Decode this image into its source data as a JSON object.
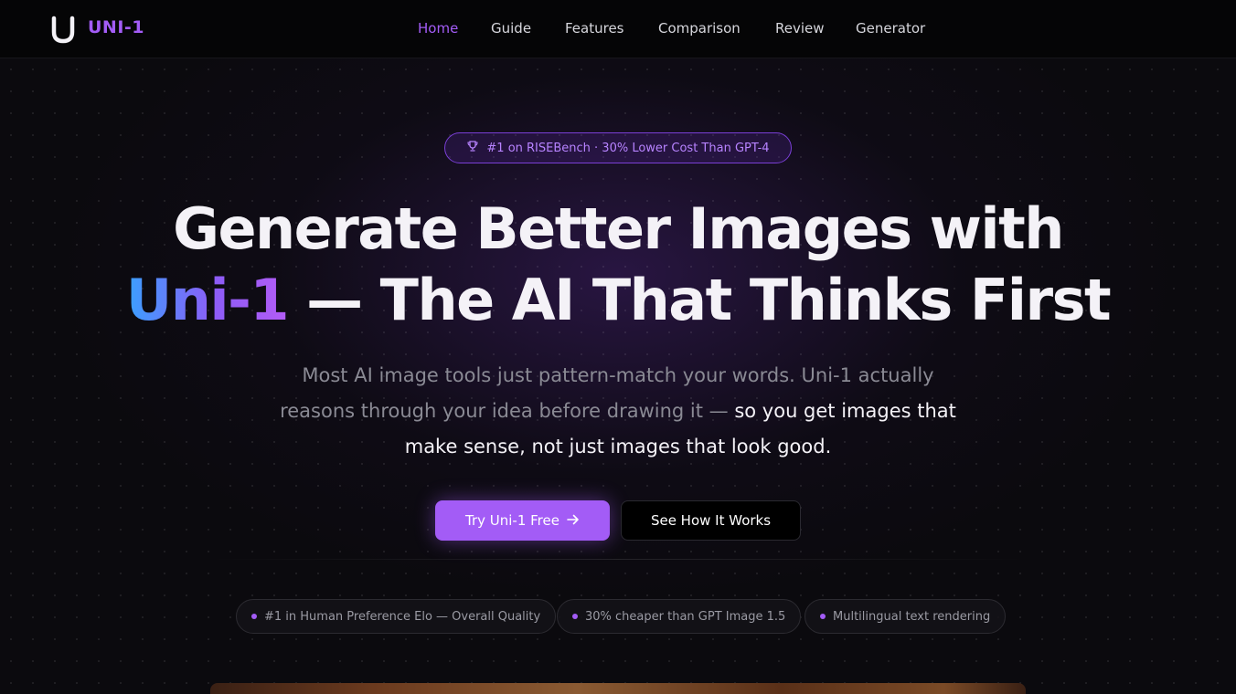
{
  "brand": {
    "name": "UNI-1",
    "logo_letter": "U"
  },
  "nav": {
    "items": [
      {
        "label": "Home",
        "active": true
      },
      {
        "label": "Guide"
      },
      {
        "label": "Features"
      },
      {
        "label": "Comparison"
      },
      {
        "label": "Review"
      },
      {
        "label": "Generator"
      }
    ]
  },
  "hero": {
    "badge": "#1 on RISEBench · 30% Lower Cost Than GPT-4",
    "badge_icon": "trophy-icon",
    "title_line1": "Generate Better Images with",
    "title_accent": "Uni-1",
    "title_line2_rest": " — The AI That Thinks First",
    "subtitle_muted": "Most AI image tools just pattern-match your words. Uni-1 actually reasons through your idea before drawing it — ",
    "subtitle_strong": "so you get images that make sense, not just images that look good.",
    "cta_primary": "Try Uni-1 Free",
    "cta_primary_icon": "arrow-right-icon",
    "cta_secondary": "See How It Works"
  },
  "highlights": [
    "#1 in Human Preference Elo — Overall Quality",
    "30% cheaper than GPT Image 1.5",
    "Multilingual text rendering"
  ],
  "colors": {
    "accent": "#a35cf6",
    "background": "#0b0a0e",
    "gradient_start": "#3aa0ff"
  }
}
